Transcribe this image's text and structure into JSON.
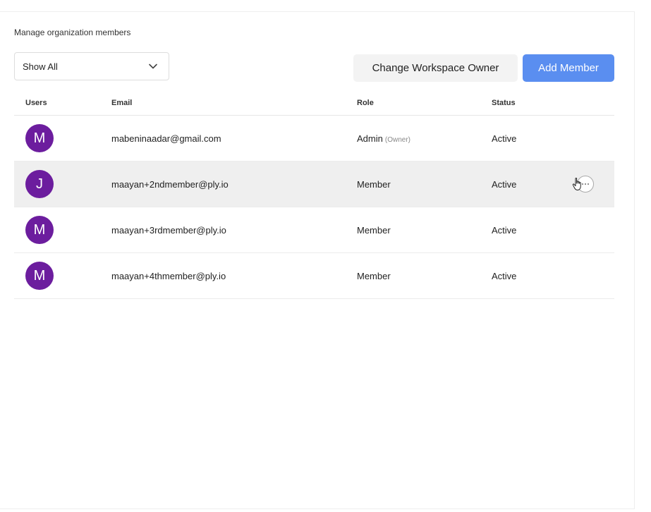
{
  "header": {
    "subtitle": "Manage organization members"
  },
  "filter": {
    "selected": "Show All",
    "icon": "chevron-down-icon"
  },
  "toolbar": {
    "change_owner_label": "Change Workspace Owner",
    "add_member_label": "Add Member",
    "primary_color": "#5a8ef0"
  },
  "table": {
    "columns": {
      "users": "Users",
      "email": "Email",
      "role": "Role",
      "status": "Status"
    },
    "rows": [
      {
        "initial": "M",
        "email": "mabeninaadar@gmail.com",
        "role": "Admin",
        "role_tag": "(Owner)",
        "status": "Active"
      },
      {
        "initial": "J",
        "email": "maayan+2ndmember@ply.io",
        "role": "Member",
        "status": "Active"
      },
      {
        "initial": "M",
        "email": "maayan+3rdmember@ply.io",
        "role": "Member",
        "status": "Active"
      },
      {
        "initial": "M",
        "email": "maayan+4thmember@ply.io",
        "role": "Member",
        "status": "Active"
      }
    ],
    "avatar_color": "#6c1d9e",
    "row_actions_icon": "more-horizontal-icon"
  }
}
